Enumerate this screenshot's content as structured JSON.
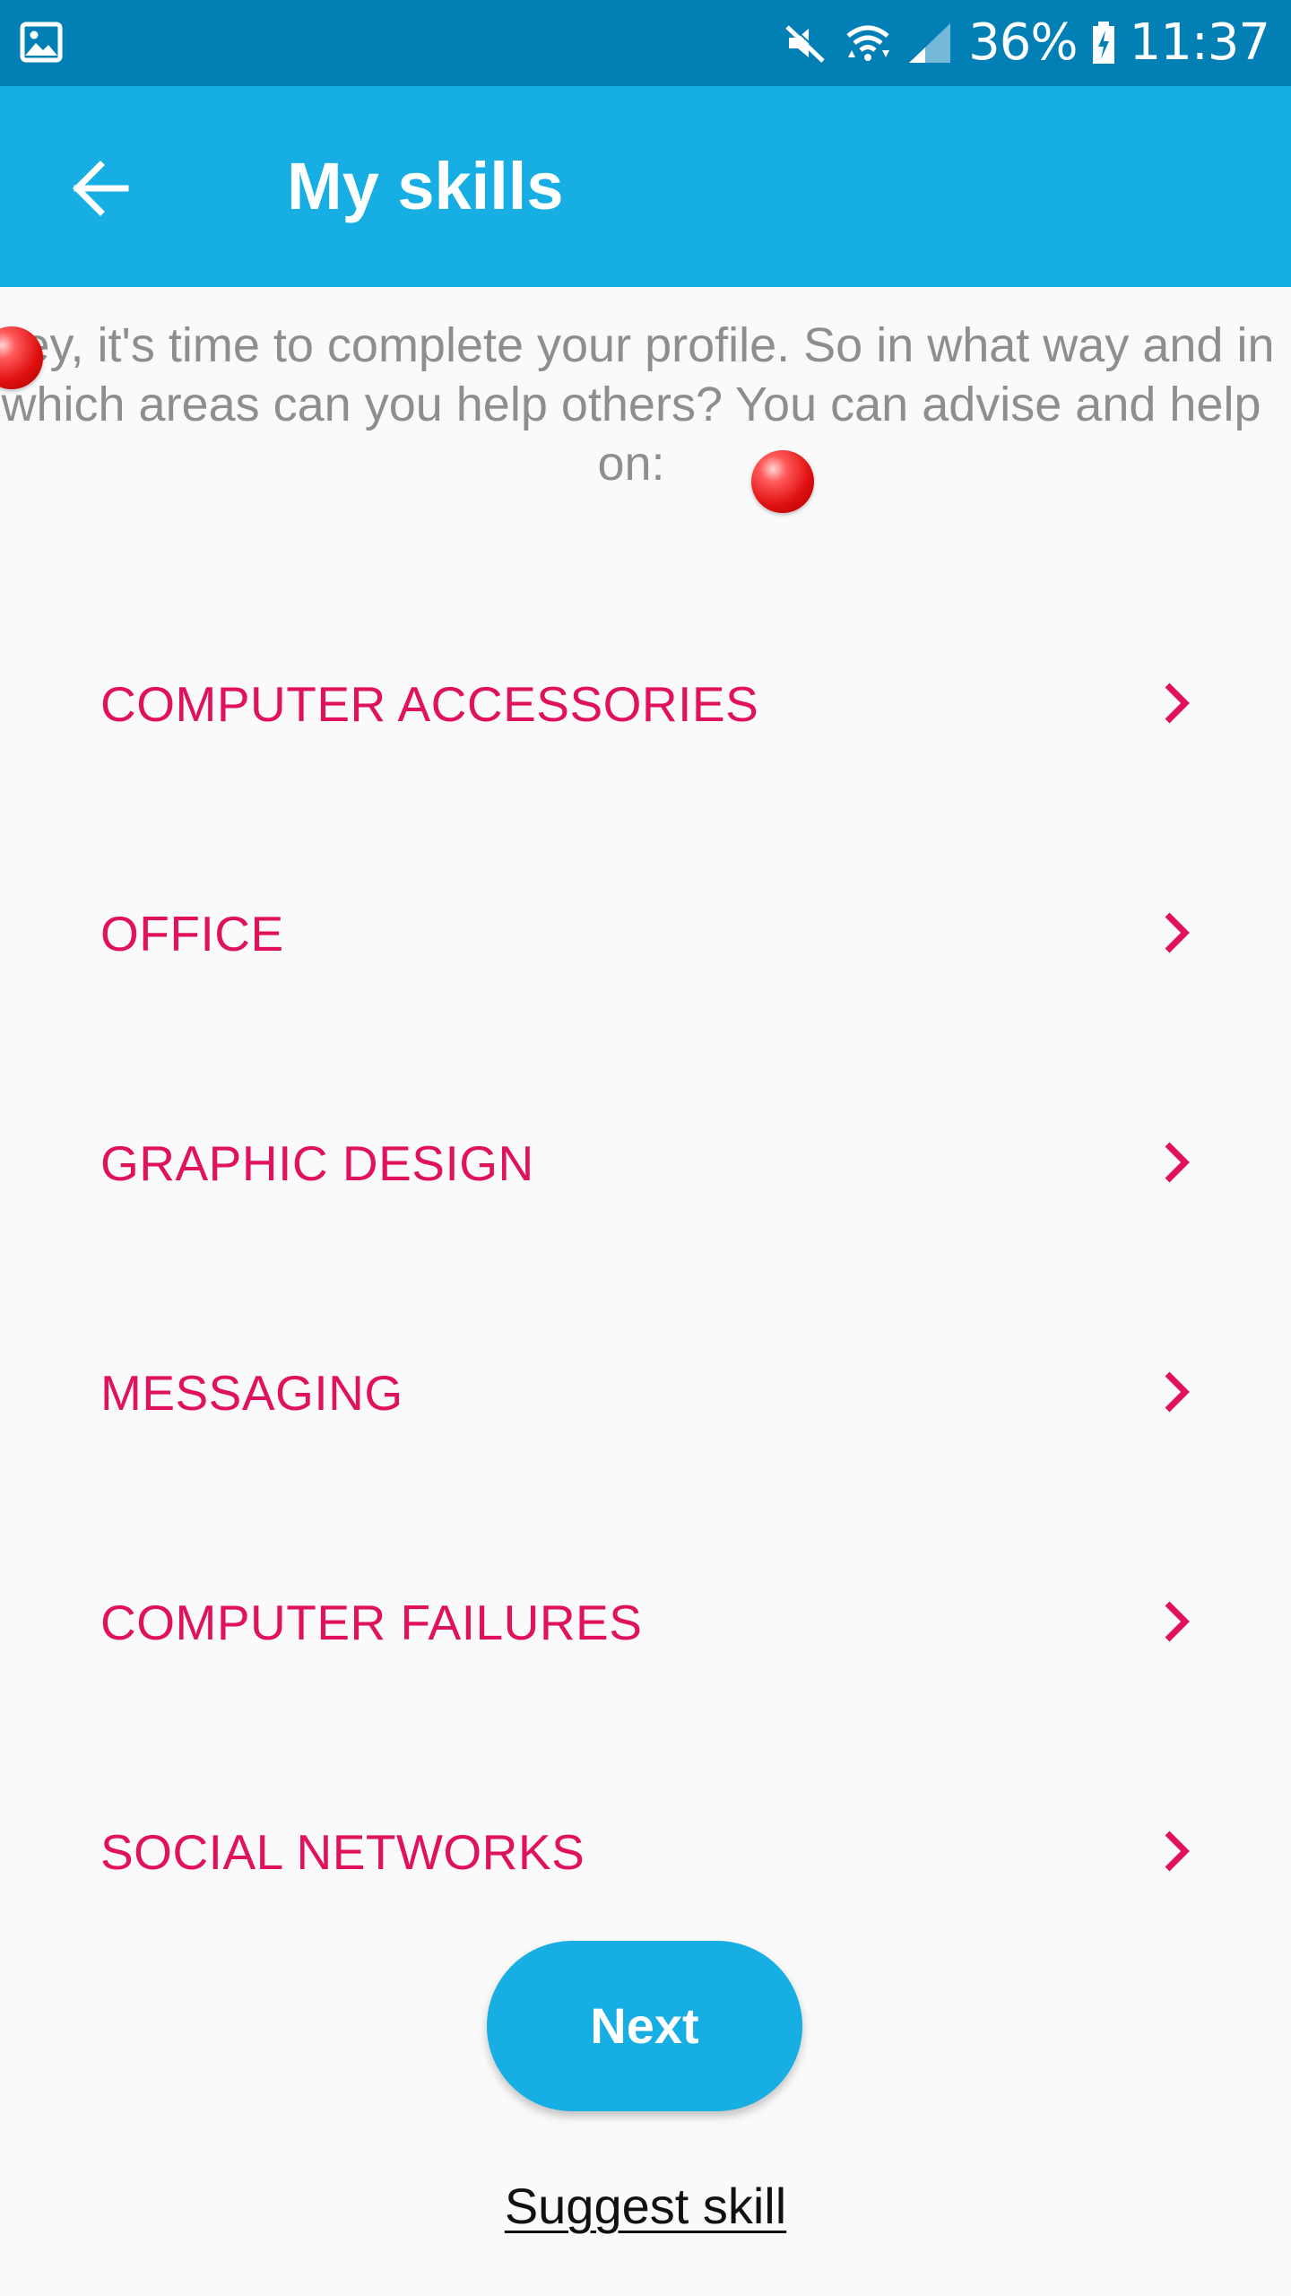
{
  "status_bar": {
    "battery": "36%",
    "time": "11:37",
    "icons": [
      "image-notification-icon",
      "mute-icon",
      "wifi-icon",
      "signal-icon",
      "battery-charging-icon"
    ]
  },
  "toolbar": {
    "title": "My skills",
    "back_icon": "arrow-left-icon"
  },
  "intro": {
    "text": "Hey, it's time to complete your profile. So in what way and in which areas can you help others? You can advise and help on:"
  },
  "skills": [
    {
      "label": "COMPUTER ACCESSORIES"
    },
    {
      "label": "OFFICE"
    },
    {
      "label": "GRAPHIC DESIGN"
    },
    {
      "label": "MESSAGING"
    },
    {
      "label": "COMPUTER FAILURES"
    },
    {
      "label": "SOCIAL NETWORKS"
    }
  ],
  "next_button": {
    "label": "Next"
  },
  "suggest_link": {
    "label": "Suggest skill"
  },
  "colors": {
    "status_bar": "#0280b6",
    "toolbar": "#16aee3",
    "accent": "#e0125e",
    "background": "#fafafa",
    "intro_text": "#8e8e8e"
  }
}
